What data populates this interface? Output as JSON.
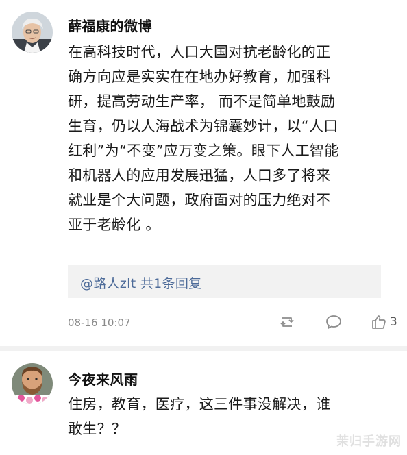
{
  "post1": {
    "username": "薛福康的微博",
    "content_lines": [
      "在高科技时代，人口大国对抗老龄化的正",
      "确方向应是实实在在地办好教育，加强科",
      "研，提高劳动生产率， 而不是简单地鼓励",
      "生育，仍以人海战术为锦囊妙计，以“人口",
      "红利”为“不变”应万变之策。眼下人工智能",
      "和机器人的应用发展迅猛，人口多了将来",
      "就业是个大问题，政府面对的压力绝对不",
      "亚于老龄化 。"
    ],
    "reply_preview": "@路人zlt  共1条回复",
    "timestamp": "08-16 10:07",
    "like_count": "3",
    "icons": [
      "repost-icon",
      "comment-icon",
      "like-icon"
    ]
  },
  "post2": {
    "username": "今夜来风雨",
    "content_lines": [
      "住房，教育，医疗，这三件事没解决，谁",
      "敢生？？"
    ]
  },
  "watermark": "茉归手游网",
  "colors": {
    "reply_link": "#4d6b99",
    "meta_gray": "#8a8a8a",
    "divider": "#f1f1f1",
    "reply_bg": "#f2f2f2"
  }
}
